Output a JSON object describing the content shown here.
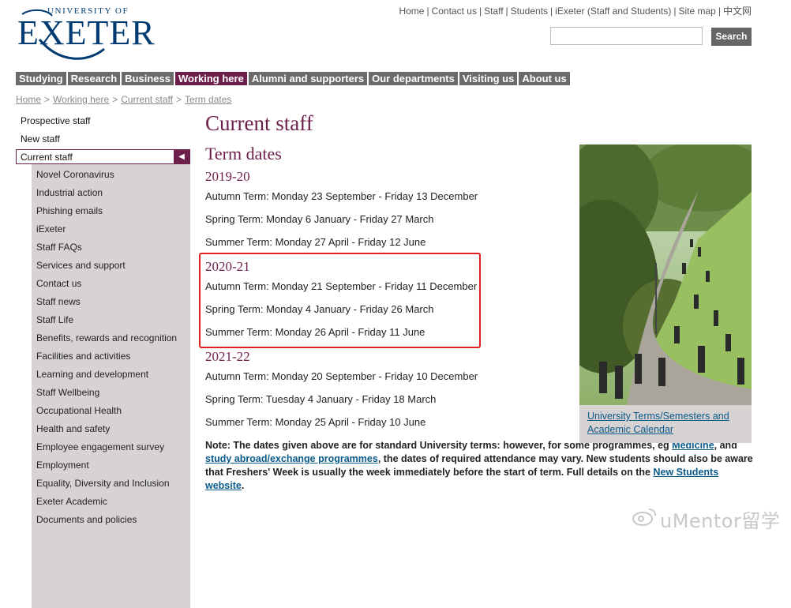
{
  "logo": {
    "line1": "UNIVERSITY OF",
    "line2": "EXETER"
  },
  "toplinks": [
    {
      "label": "Home"
    },
    {
      "label": "Contact us"
    },
    {
      "label": "Staff"
    },
    {
      "label": "Students"
    },
    {
      "label": "iExeter (Staff and Students)"
    },
    {
      "label": "Site map"
    },
    {
      "label": "中文网"
    }
  ],
  "search": {
    "value": "",
    "button_label": "Search"
  },
  "mainnav": [
    {
      "label": "Studying"
    },
    {
      "label": "Research"
    },
    {
      "label": "Business"
    },
    {
      "label": "Working here",
      "active": true
    },
    {
      "label": "Alumni and supporters"
    },
    {
      "label": "Our departments"
    },
    {
      "label": "Visiting us"
    },
    {
      "label": "About us"
    }
  ],
  "breadcrumb": [
    "Home",
    "Working here",
    "Current staff",
    "Term dates"
  ],
  "sidebar": {
    "top_items": [
      "Prospective staff",
      "New staff"
    ],
    "current": "Current staff",
    "sub_items": [
      "Novel Coronavirus",
      "Industrial action",
      "Phishing emails",
      "iExeter",
      "Staff FAQs",
      "Services and support",
      "Contact us",
      "Staff news",
      "Staff Life",
      "Benefits, rewards and recognition",
      "Facilities and activities",
      "Learning and development",
      "Staff Wellbeing",
      "Occupational Health",
      "Health and safety",
      "Employee engagement survey",
      "Employment",
      "Equality, Diversity and Inclusion",
      "Exeter Academic",
      "Documents and policies"
    ]
  },
  "content": {
    "page_title": "Current staff",
    "section_title": "Term dates",
    "years": [
      {
        "year": "2019-20",
        "terms": [
          "Autumn Term: Monday 23 September - Friday 13 December",
          "Spring Term: Monday 6 January - Friday 27 March",
          "Summer Term: Monday 27 April - Friday 12 June"
        ]
      },
      {
        "year": "2020-21",
        "terms": [
          "Autumn Term: Monday 21 September - Friday 11 December",
          "Spring Term: Monday 4 January - Friday 26 March",
          "Summer Term: Monday 26 April - Friday 11 June"
        ]
      },
      {
        "year": "2021-22",
        "terms": [
          "Autumn Term: Monday 20 September - Friday 10 December",
          "Spring Term: Tuesday 4 January - Friday 18 March",
          "Summer Term: Monday 25 April - Friday 10 June"
        ]
      }
    ],
    "note": {
      "part1": "Note: The dates given above are for standard University terms: however, for some programmes, eg ",
      "link1": "Medicine",
      "part2": ", and ",
      "link2": "study abroad/exchange programmes",
      "part3": ", the dates of required attendance may vary. New students should also be aware that Freshers' Week is usually the week immediately before the start of term. Full details on the ",
      "link3": "New Students website",
      "part4": "."
    }
  },
  "photo_card": {
    "caption": "University Terms/Semesters and Academic Calendar"
  },
  "watermark": {
    "text": "uMentor留学"
  },
  "colors": {
    "brand": "#6d1f4c",
    "nav": "#6b6b6b",
    "link": "#0a5a8a",
    "highlight": "#e02020",
    "sidebar_bg": "#d8d3d3"
  }
}
